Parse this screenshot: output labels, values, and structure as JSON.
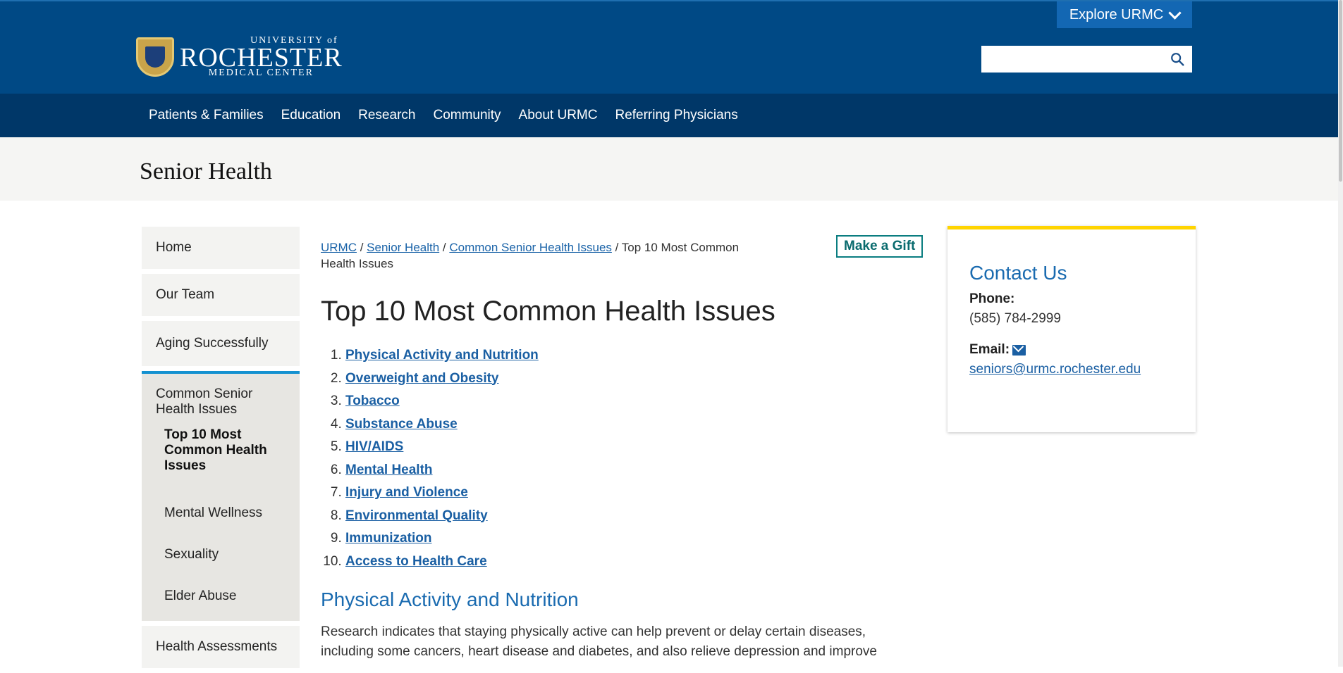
{
  "header": {
    "explore_label": "Explore URMC",
    "logo": {
      "line1": "UNIVERSITY of",
      "line2": "ROCHESTER",
      "line3": "MEDICAL CENTER"
    },
    "search_placeholder": ""
  },
  "nav": {
    "items": [
      "Patients & Families",
      "Education",
      "Research",
      "Community",
      "About URMC",
      "Referring Physicians"
    ]
  },
  "section_title": "Senior Health",
  "sidebar": {
    "items_top": [
      "Home",
      "Our Team",
      "Aging Successfully"
    ],
    "active_parent": "Common Senior Health Issues",
    "active_current": "Top 10 Most Common Health Issues",
    "active_children": [
      "Mental Wellness",
      "Sexuality",
      "Elder Abuse"
    ],
    "items_bottom": [
      "Health Assessments"
    ]
  },
  "breadcrumb": {
    "links": [
      "URMC",
      "Senior Health",
      "Common Senior Health Issues"
    ],
    "current": "Top 10 Most Common Health Issues",
    "separator": " / "
  },
  "gift_label": "Make a Gift",
  "page_title": "Top 10 Most Common Health Issues",
  "toc": [
    "Physical Activity and Nutrition",
    "Overweight and Obesity",
    "Tobacco",
    "Substance Abuse",
    "HIV/AIDS",
    "Mental Health",
    "Injury and Violence",
    "Environmental Quality",
    "Immunization",
    "Access to Health Care"
  ],
  "section1": {
    "heading": "Physical Activity and Nutrition",
    "text": "Research indicates that staying physically active can help prevent or delay certain diseases, including some cancers, heart disease and diabetes, and also relieve depression and improve"
  },
  "contact": {
    "heading": "Contact Us",
    "phone_label": "Phone:",
    "phone": "(585) 784-2999",
    "email_label": "Email:",
    "email": "seniors@urmc.rochester.edu"
  },
  "colors": {
    "header_blue": "#004985",
    "nav_blue": "#003768",
    "link_blue": "#1a5fa3",
    "accent_yellow": "#ffd400",
    "sidebar_active_border": "#1491d0"
  }
}
